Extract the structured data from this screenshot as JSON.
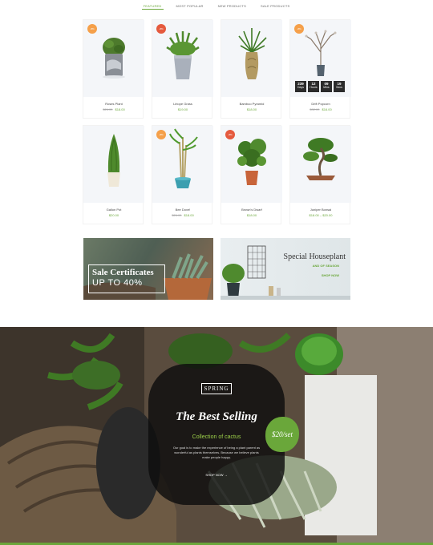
{
  "tabs": [
    "FEATURED",
    "MOST POPULAR",
    "NEW PRODUCTS",
    "SALE PRODUCTS"
  ],
  "products": [
    {
      "name": "Roses Plant",
      "old_price": "$26.00",
      "price": "$18.00",
      "badge": "-8%",
      "badge_color": "#f5a04a",
      "plant": "potted-topiary"
    },
    {
      "name": "Liriope Grass",
      "old_price": "",
      "price": "$19.00",
      "badge": "-8%",
      "badge_color": "#e55a3e",
      "plant": "grass-in-grey-pot"
    },
    {
      "name": "Bamboo Pyramid",
      "old_price": "",
      "price": "$18.00",
      "badge": "",
      "badge_color": "",
      "plant": "bamboo-vase"
    },
    {
      "name": "Drift Popcorn",
      "old_price": "$32.00",
      "price": "$16.00",
      "badge": "-8%",
      "badge_color": "#f5a04a",
      "plant": "bare-branch"
    },
    {
      "name": "Gallon Pot",
      "old_price": "",
      "price": "$20.00",
      "badge": "",
      "badge_color": "",
      "plant": "cypress"
    },
    {
      "name": "Bee Dove!",
      "old_price": "$26.00",
      "price": "$18.00",
      "badge": "-8%",
      "badge_color": "#f5a04a",
      "plant": "lucky-bamboo"
    },
    {
      "name": "Brown's Dwarf",
      "old_price": "",
      "price": "$18.00",
      "badge": "-8%",
      "badge_color": "#e55a3e",
      "plant": "dwarf-shrub"
    },
    {
      "name": "Juniper Bonsai",
      "old_price": "",
      "price": "$18.00 – $20.00",
      "badge": "",
      "badge_color": "",
      "plant": "bonsai"
    }
  ],
  "countdown": [
    {
      "value": "239",
      "label": "Days"
    },
    {
      "value": "12",
      "label": "Hours"
    },
    {
      "value": "09",
      "label": "Mins"
    },
    {
      "value": "19",
      "label": "Secs"
    }
  ],
  "banners": {
    "left": {
      "title": "Sale Certificates",
      "subtitle": "UP TO 40%"
    },
    "right": {
      "title": "Special Houseplant",
      "subtitle": "AND OF SEASON",
      "cta": "SHOP NOW"
    }
  },
  "hero": {
    "logo": "SPRING",
    "title": "The Best Selling",
    "subtitle": "Collection of cactus",
    "description": "Our goal is to make the experience of being a plant parent as wonderful as plants themselves. Because we believe plants make people happy.",
    "cta": "SHOP NOW",
    "price_tag": "$20/set"
  },
  "colors": {
    "accent": "#6aa73a",
    "badge_orange": "#f5a04a",
    "badge_red": "#e55a3e"
  }
}
